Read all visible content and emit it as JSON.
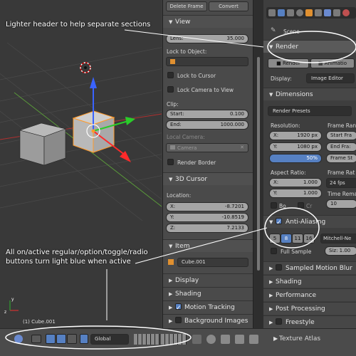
{
  "annotations": {
    "header_note": "Lighter header to help separate sections",
    "button_note_line1": "All on/active regular/option/toggle/radio",
    "button_note_line2": "buttons turn light blue when active"
  },
  "viewport": {
    "object_label": "(1) Cube.001"
  },
  "npanel": {
    "top_buttons": [
      "Delete Frame",
      "Convert"
    ],
    "view": {
      "header": "View",
      "lens_label": "Lens:",
      "lens_value": "35.000",
      "lock_to_object_label": "Lock to Object:",
      "lock_to_cursor": "Lock to Cursor",
      "lock_camera_to_view": "Lock Camera to View",
      "clip_label": "Clip:",
      "start_label": "Start:",
      "start_value": "0.100",
      "end_label": "End:",
      "end_value": "1000.000",
      "local_camera_label": "Local Camera:",
      "camera_value": "Camera",
      "render_border": "Render Border"
    },
    "cursor": {
      "header": "3D Cursor",
      "location_label": "Location:",
      "x_label": "X:",
      "x_value": "-8.7201",
      "y_label": "Y:",
      "y_value": "-10.8519",
      "z_label": "Z:",
      "z_value": "7.2133"
    },
    "item": {
      "header": "Item",
      "name": "Cube.001"
    },
    "sections": [
      "Display",
      "Shading",
      "Motion Tracking",
      "Background Images"
    ]
  },
  "props": {
    "scene_label": "Scene",
    "render_header": "Render",
    "tabs": [
      "Render",
      "Animatio"
    ],
    "display_label": "Display:",
    "display_value": "Image Editor",
    "dimensions_header": "Dimensions",
    "render_presets": "Render Presets",
    "resolution_label": "Resolution:",
    "res_x_label": "X:",
    "res_x_value": "1920 px",
    "res_y_label": "Y:",
    "res_y_value": "1080 px",
    "res_percent": "50%",
    "frame_range_label": "Frame Ran",
    "start_frame": "Start Fra",
    "end_frame": "End Fra:",
    "frame_step": "Frame St",
    "aspect_label": "Aspect Ratio:",
    "asp_x_label": "X:",
    "asp_x_value": "1.000",
    "asp_y_label": "Y:",
    "asp_y_value": "1.000",
    "frame_rate_label": "Frame Rat",
    "fps_value": "24 fps",
    "time_remap_label": "Time Rema",
    "time_remap_value": "10",
    "border_label": "Bo",
    "crop_label": "Cr",
    "aa_header": "Anti-Aliasing",
    "aa_samples": [
      "5",
      "8",
      "11",
      "16"
    ],
    "aa_filter": "Mitchell-Ne",
    "full_sample": "Full Sample",
    "size_value": "Siz: 1.00",
    "sections": [
      "Sampled Motion Blur",
      "Shading",
      "Performance",
      "Post Processing",
      "Freestyle",
      "Texture Atlas"
    ]
  },
  "toolbar": {
    "orientation": "Global"
  },
  "colors": {
    "active_blue": "#5680c2",
    "cube_outline": "#ff9a2a"
  }
}
